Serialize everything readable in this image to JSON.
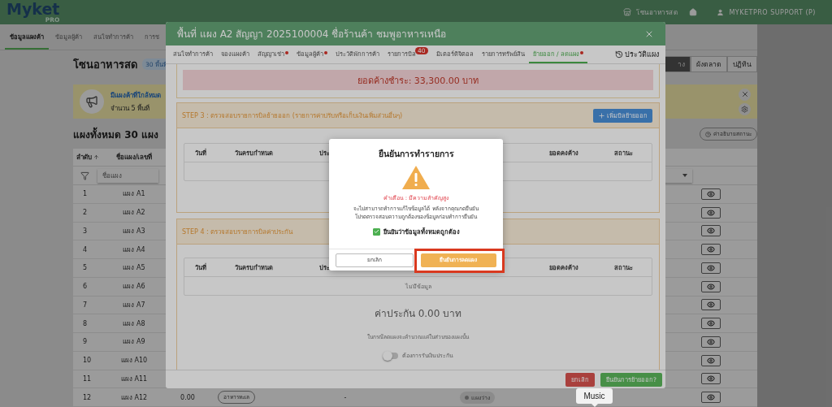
{
  "header": {
    "logo": "Myket",
    "logo_sub": "PRO",
    "zone": "โซนอาหารสด",
    "user": "MYKETPRO SUPPORT (P)"
  },
  "nav_tabs": [
    {
      "label": "ข้อมูลแผงค้า",
      "selected": true
    },
    {
      "label": "ข้อมูลผู้ค้า",
      "selected": false
    },
    {
      "label": "สนใจทำการค้า",
      "selected": false
    },
    {
      "label": "การช",
      "selected": false
    }
  ],
  "zone": {
    "title": "โซนอาหารสด",
    "badge": "30 พื้นที่"
  },
  "view_buttons": [
    {
      "label": "าง",
      "selected": true
    },
    {
      "label": "ผังตลาด",
      "selected": false
    },
    {
      "label": "ปฏิทิน",
      "selected": false
    }
  ],
  "alert": {
    "title": "มีแผงค้าที่ใกล้หมด",
    "count": "จำนวน 5 พื้นที่"
  },
  "total_title": "แผงทั้งหมด 30 แผง",
  "legend_button": "ค่าอธิบายสถานะ",
  "table": {
    "columns": [
      "ลำดับ",
      "ชื่อแผง/เลขที่"
    ],
    "filter_placeholder": "ชื่อแผง",
    "rows": [
      {
        "no": "1",
        "name": "แผง A1"
      },
      {
        "no": "2",
        "name": "แผง A2"
      },
      {
        "no": "3",
        "name": "แผง A3"
      },
      {
        "no": "4",
        "name": "แผง A4"
      },
      {
        "no": "5",
        "name": "แผง A5"
      },
      {
        "no": "6",
        "name": "แผง A6"
      },
      {
        "no": "7",
        "name": "แผง A7"
      },
      {
        "no": "8",
        "name": "แผง A8"
      },
      {
        "no": "9",
        "name": "แผง A9"
      },
      {
        "no": "10",
        "name": "แผง A10"
      },
      {
        "no": "11",
        "name": "แผง A11"
      },
      {
        "no": "12",
        "name": "แผง A12",
        "price": "0.00",
        "category": "อาหารทะเล",
        "column_5": "-",
        "status": "แผงว่าง"
      }
    ]
  },
  "modal": {
    "title": "พื้นที่ แผง A2 สัญญา 2025100004 ชื่อร้านค้า ชมพูอาหารเหนือ",
    "tabs": [
      {
        "label": "สนใจทำการค้า",
        "selected": false,
        "has_dot": false
      },
      {
        "label": "จองแผงค้า",
        "selected": false,
        "has_dot": false
      },
      {
        "label": "สัญญาเช่า",
        "selected": false,
        "has_dot": true
      },
      {
        "label": "ข้อมูลผู้ค้า",
        "selected": false,
        "has_dot": true
      },
      {
        "label": "ประวัติพักการค้า",
        "selected": false,
        "has_dot": false
      },
      {
        "label": "รายการบิล",
        "selected": false,
        "has_dot": false,
        "badge": "40"
      },
      {
        "label": "มิเตอร์ดิจิตอล",
        "selected": false,
        "has_dot": false
      },
      {
        "label": "รายการทรัพย์สิน",
        "selected": false,
        "has_dot": false
      },
      {
        "label": "ย้ายออก / ลดแผง",
        "selected": true,
        "has_dot": true
      }
    ],
    "history_button": "ประวัติแผง",
    "outstanding": "ยอดค้างชำระ: 33,300.00 บาท",
    "step3": {
      "title": "STEP 3 : ตรวจสอบรายการบิลย้ายออก (รายการค่าปรับหรือเก็บเงินเพิ่มส่วนอื่นๆ)",
      "add_button": "เพิ่มบิลย้ายออก",
      "columns": [
        "วันที่",
        "วันครบกำหนด",
        "ประ",
        "ยอดคงค้าง",
        "สถานะ"
      ]
    },
    "step4": {
      "title": "STEP 4 : ตรวจสอบรายการบิลค่าประกัน",
      "columns": [
        "วันที่",
        "วันครบกำหนด",
        "ประ",
        "ยอดคงค้าง",
        "สถานะ"
      ],
      "empty": "ไม่มีข้อมูล",
      "deposit": "ค่าประกัน 0.00 บาท",
      "note": "ในกรณีลดแผงจะคำนวณแค่ในส่วนของแผงนั้น",
      "refund_toggle": {
        "label": "ต้องการรับเงินประกัน",
        "on": false
      }
    },
    "buttons": [
      {
        "label": "ยกเลิก",
        "kind": "danger"
      },
      {
        "label": "ยืนยันการย้ายออก?",
        "kind": "success"
      }
    ]
  },
  "dialog": {
    "title": "ยืนยันการทำรายการ",
    "warning": "คำเตือน : มีความสำคัญสูง",
    "message": [
      "จะไม่สามารถทำการแก้ไขข้อมูลได้ หลังจากคุณกดยืนยัน",
      "โปรดตรวจสอบความถูกต้องของข้อมูลก่อนทำการยืนยัน"
    ],
    "confirm_check": {
      "label": "ยืนยันว่าข้อมูลทั้งหมดถูกต้อง",
      "checked": true
    },
    "cancel": "ยกเลิก",
    "confirm": "ยืนยันการลดแผง",
    "confirm_highlighted": true
  },
  "tooltip": "Music"
}
